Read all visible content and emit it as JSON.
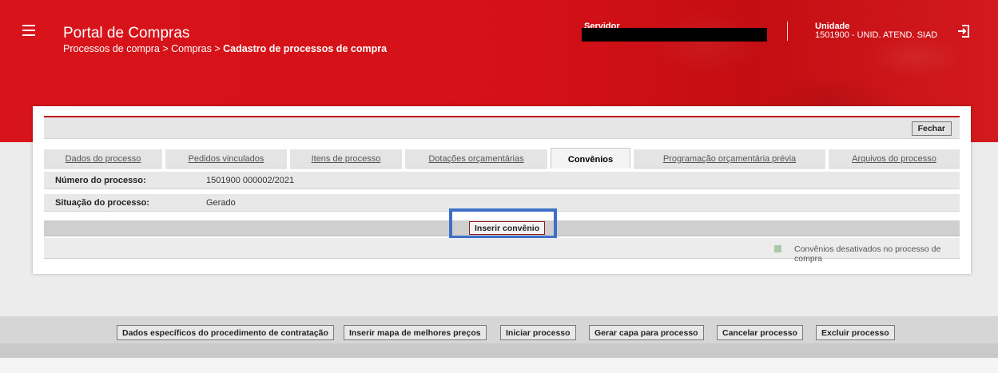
{
  "header": {
    "app_title": "Portal de Compras",
    "breadcrumb_path": "Processos de compra > Compras > ",
    "breadcrumb_current": "Cadastro de processos de compra",
    "servidor_label": "Servidor",
    "unidade_label": "Unidade",
    "unidade_value": "1501900 - UNID. ATEND. SIAD"
  },
  "toolbar": {
    "fechar_label": "Fechar"
  },
  "tabs": [
    {
      "label": "Dados do processo",
      "active": false
    },
    {
      "label": "Pedidos vinculados",
      "active": false
    },
    {
      "label": "Itens de processo",
      "active": false
    },
    {
      "label": "Dotações orçamentárias",
      "active": false
    },
    {
      "label": "Convênios",
      "active": true
    },
    {
      "label": "Programação orçamentária prévia",
      "active": false
    },
    {
      "label": "Arquivos do processo",
      "active": false
    }
  ],
  "fields": {
    "numero_label": "Número do processo:",
    "numero_value": "1501900 000002/2021",
    "situacao_label": "Situação do processo:",
    "situacao_value": "Gerado"
  },
  "actions": {
    "inserir_convenio_label": "Inserir convênio"
  },
  "legend": {
    "text": "Convênios desativados no processo de compra",
    "color": "#a9c7a9"
  },
  "bottom_buttons": {
    "dados_especificos": "Dados específicos do procedimento de contratação",
    "inserir_mapa": "Inserir mapa de melhores preços",
    "iniciar": "Iniciar processo",
    "gerar_capa": "Gerar capa para processo",
    "cancelar": "Cancelar processo",
    "excluir": "Excluir processo"
  },
  "colors": {
    "brand_red": "#d8141b",
    "highlight": "#3f6fc9"
  }
}
